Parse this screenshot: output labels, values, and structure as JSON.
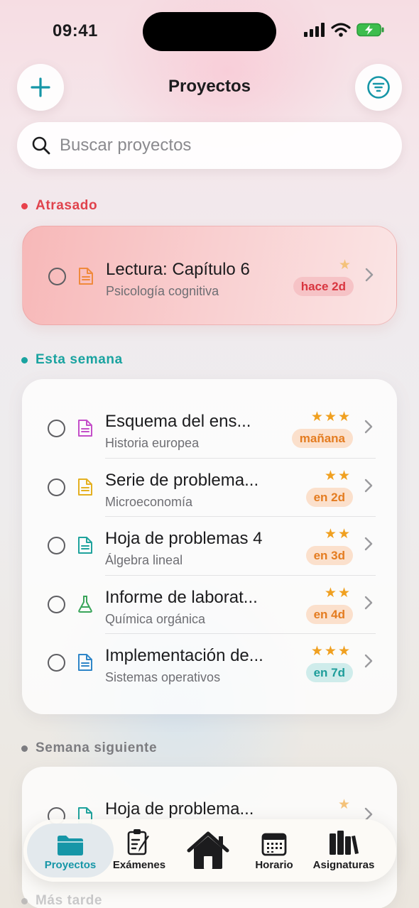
{
  "status_bar": {
    "time": "09:41"
  },
  "header": {
    "title": "Proyectos",
    "add_icon": "plus-icon",
    "filter_icon": "filter-icon"
  },
  "search": {
    "placeholder": "Buscar proyectos",
    "icon": "search-icon"
  },
  "colors": {
    "accent": "#1696a7",
    "overdue": "#e0424c",
    "week": "#1aa3a0",
    "next": "#7c7c80",
    "star": "#f0a020"
  },
  "sections": {
    "overdue": {
      "label": "Atrasado",
      "items": [
        {
          "title": "Lectura: Capítulo 6",
          "subtitle": "Psicología cognitiva",
          "stars": "★",
          "badge": "hace 2d",
          "icon_color": "#f08a3c"
        }
      ]
    },
    "this_week": {
      "label": "Esta semana",
      "items": [
        {
          "title": "Esquema del ens...",
          "subtitle": "Historia europea",
          "stars": "★★★",
          "badge": "mañana",
          "icon_color": "#c44fc9"
        },
        {
          "title": "Serie de problema...",
          "subtitle": "Microeconomía",
          "stars": "★★",
          "badge": "en 2d",
          "icon_color": "#e4b021"
        },
        {
          "title": "Hoja de problemas 4",
          "subtitle": "Álgebra lineal",
          "stars": "★★",
          "badge": "en 3d",
          "icon_color": "#1fa39d"
        },
        {
          "title": "Informe de laborat...",
          "subtitle": "Química orgánica",
          "stars": "★★",
          "badge": "en 4d",
          "icon_color": "#3aa55a"
        },
        {
          "title": "Implementación de...",
          "subtitle": "Sistemas operativos",
          "stars": "★★★",
          "badge": "en 7d",
          "icon_color": "#2f86c8"
        }
      ]
    },
    "next_week": {
      "label": "Semana siguiente",
      "items": [
        {
          "title": "Hoja de problema...",
          "stars": "★",
          "icon_color": "#1fa39d"
        }
      ]
    },
    "later": {
      "label": "Más tarde"
    }
  },
  "tabbar": {
    "tabs": [
      {
        "label": "Proyectos",
        "icon": "folder-icon",
        "active": true
      },
      {
        "label": "Exámenes",
        "icon": "exam-edit-icon"
      },
      {
        "label": "",
        "icon": "home-icon"
      },
      {
        "label": "Horario",
        "icon": "calendar-icon"
      },
      {
        "label": "Asignaturas",
        "icon": "books-icon"
      }
    ]
  }
}
